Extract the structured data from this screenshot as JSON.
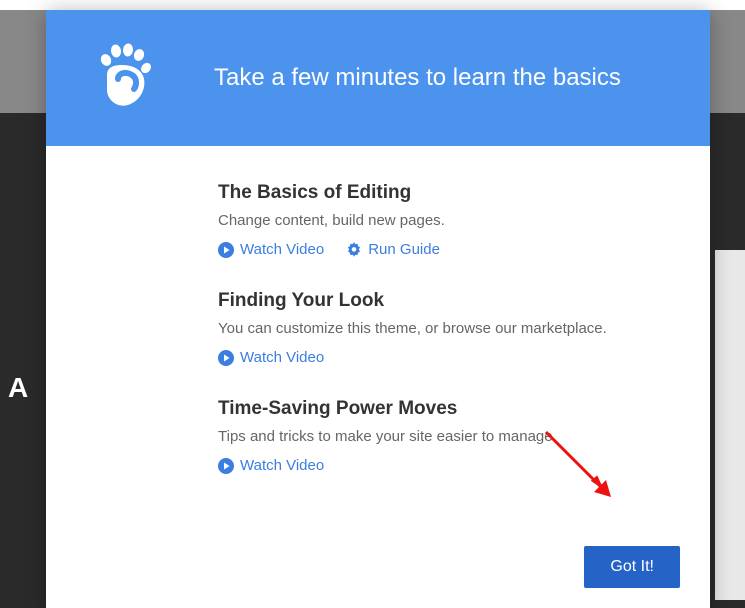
{
  "header": {
    "title": "Take a few minutes to learn the basics"
  },
  "sections": [
    {
      "title": "The Basics of Editing",
      "desc": "Change content, build new pages.",
      "watch_video": "Watch Video",
      "run_guide": "Run Guide"
    },
    {
      "title": "Finding Your Look",
      "desc": "You can customize this theme, or browse our marketplace.",
      "watch_video": "Watch Video"
    },
    {
      "title": "Time-Saving Power Moves",
      "desc": "Tips and tricks to make your site easier to manage.",
      "watch_video": "Watch Video"
    }
  ],
  "footer": {
    "button_label": "Got It!"
  },
  "backdrop": {
    "letter": "A"
  }
}
